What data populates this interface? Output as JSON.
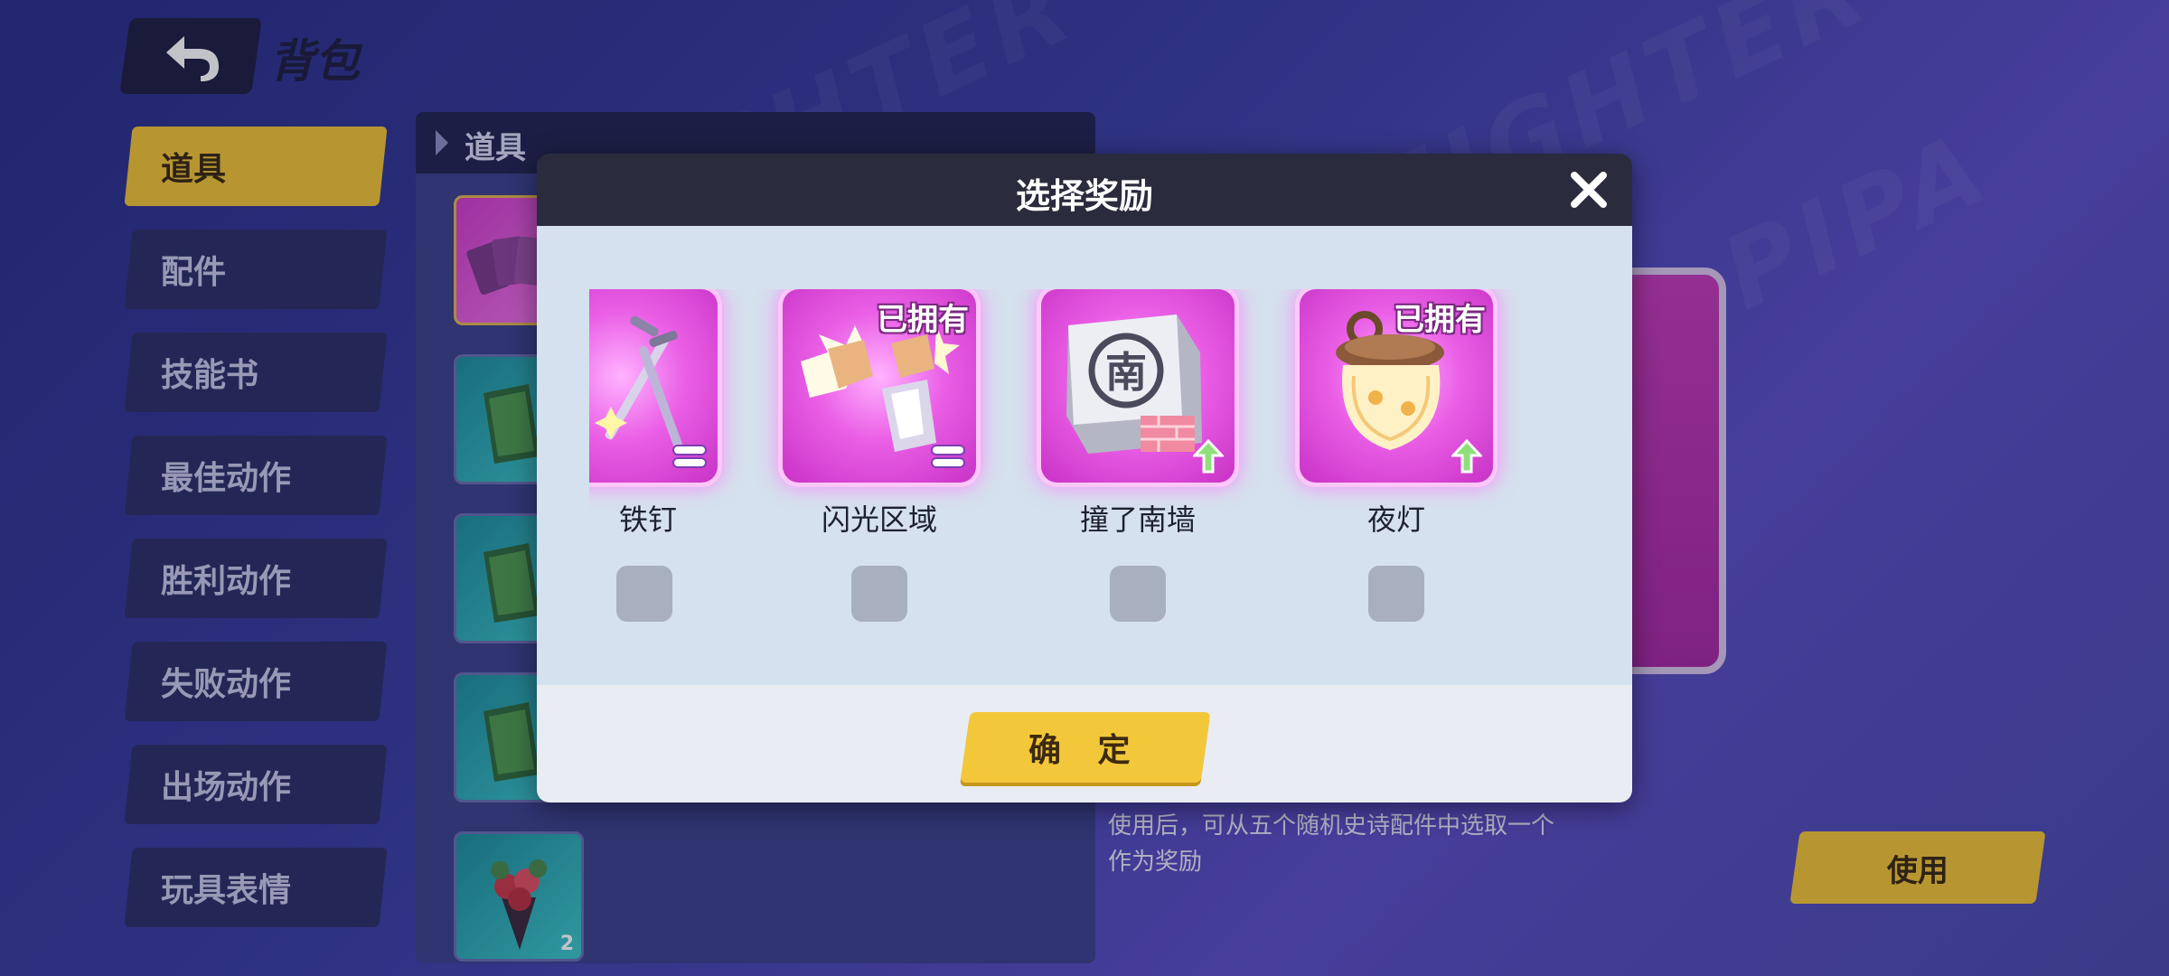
{
  "header": {
    "title": "背包"
  },
  "sidebar": {
    "tabs": [
      {
        "label": "道具"
      },
      {
        "label": "配件"
      },
      {
        "label": "技能书"
      },
      {
        "label": "最佳动作"
      },
      {
        "label": "胜利动作"
      },
      {
        "label": "失败动作"
      },
      {
        "label": "出场动作"
      },
      {
        "label": "玩具表情"
      }
    ]
  },
  "inventory": {
    "section_label": "道具",
    "slots": [
      {
        "color": "pink",
        "count": ""
      },
      {
        "color": "teal",
        "count": ""
      },
      {
        "color": "teal",
        "count": ""
      },
      {
        "color": "teal",
        "count": ""
      },
      {
        "color": "teal",
        "count": "2"
      }
    ]
  },
  "detail": {
    "description": "使用后，可从五个随机史诗配件中选取一个作为奖励",
    "use_label": "使用"
  },
  "dialog": {
    "title": "选择奖励",
    "confirm_label": "确 定",
    "rewards": [
      {
        "name": "铁钉",
        "owned": "",
        "tag": "equal-icon"
      },
      {
        "name": "闪光区域",
        "owned": "已拥有",
        "tag": "equal-icon"
      },
      {
        "name": "撞了南墙",
        "owned": "",
        "tag": "up-arrow-icon"
      },
      {
        "name": "夜灯",
        "owned": "已拥有",
        "tag": "up-arrow-icon"
      }
    ]
  },
  "colors": {
    "accent": "#f1c534",
    "card": "#ea5fe6",
    "dialog_body": "#d5e1ee"
  }
}
